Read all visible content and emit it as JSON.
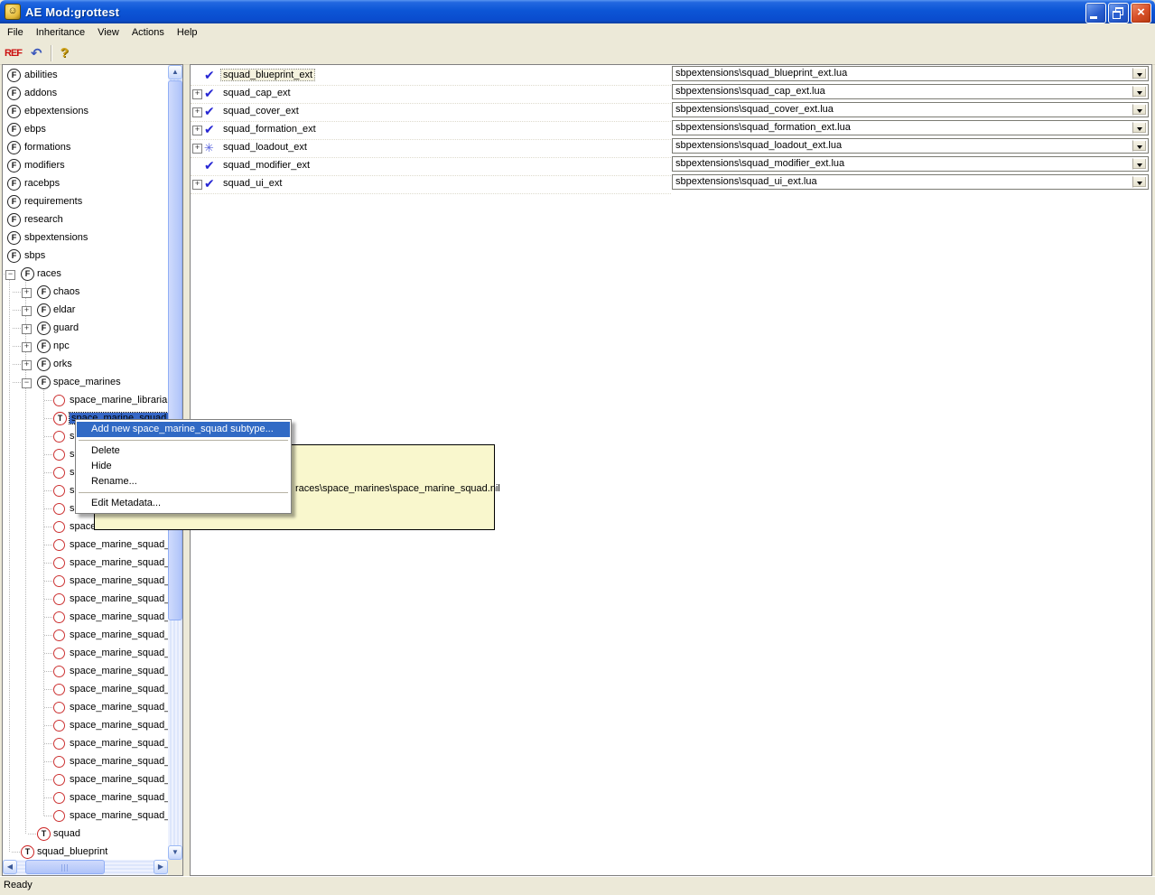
{
  "window": {
    "title": "AE Mod:grottest",
    "buttons": {
      "minimize": "minimize",
      "restore": "restore",
      "close": "close"
    }
  },
  "menu_bar": {
    "items": [
      "File",
      "Inheritance",
      "View",
      "Actions",
      "Help"
    ]
  },
  "toolbar": {
    "ref_label": "REF",
    "undo_glyph": "↶",
    "help_glyph": "?"
  },
  "tree": {
    "items": [
      {
        "label": "abilities",
        "icon": "folder-f",
        "level": 0
      },
      {
        "label": "addons",
        "icon": "folder-f",
        "level": 0
      },
      {
        "label": "ebpextensions",
        "icon": "folder-f",
        "level": 0
      },
      {
        "label": "ebps",
        "icon": "folder-f",
        "level": 0
      },
      {
        "label": "formations",
        "icon": "folder-f",
        "level": 0
      },
      {
        "label": "modifiers",
        "icon": "folder-f",
        "level": 0
      },
      {
        "label": "racebps",
        "icon": "folder-f",
        "level": 0
      },
      {
        "label": "requirements",
        "icon": "folder-f",
        "level": 0
      },
      {
        "label": "research",
        "icon": "folder-f",
        "level": 0
      },
      {
        "label": "sbpextensions",
        "icon": "folder-f",
        "level": 0
      },
      {
        "label": "sbps",
        "icon": "folder-f",
        "level": 0
      },
      {
        "label": "races",
        "icon": "folder-f",
        "level": 1,
        "box": "minus"
      },
      {
        "label": "chaos",
        "icon": "folder-f",
        "level": 2,
        "box": "plus"
      },
      {
        "label": "eldar",
        "icon": "folder-f",
        "level": 2,
        "box": "plus"
      },
      {
        "label": "guard",
        "icon": "folder-f",
        "level": 2,
        "box": "plus"
      },
      {
        "label": "npc",
        "icon": "folder-f",
        "level": 2,
        "box": "plus"
      },
      {
        "label": "orks",
        "icon": "folder-f",
        "level": 2,
        "box": "plus"
      },
      {
        "label": "space_marines",
        "icon": "folder-f",
        "level": 2,
        "box": "minus"
      },
      {
        "label": "space_marine_librarian",
        "icon": "instance",
        "level": 3
      },
      {
        "label": "space_marine_squad",
        "icon": "type-t",
        "level": 3,
        "selected": true
      },
      {
        "label": "s",
        "icon": "instance",
        "level": 3
      },
      {
        "label": "s",
        "icon": "instance",
        "level": 3
      },
      {
        "label": "s",
        "icon": "instance",
        "level": 3
      },
      {
        "label": "s",
        "icon": "instance",
        "level": 3
      },
      {
        "label": "s",
        "icon": "instance",
        "level": 3
      },
      {
        "label": "space",
        "icon": "instance",
        "level": 3
      },
      {
        "label": "space_marine_squad_",
        "icon": "instance",
        "level": 3
      },
      {
        "label": "space_marine_squad_",
        "icon": "instance",
        "level": 3
      },
      {
        "label": "space_marine_squad_",
        "icon": "instance",
        "level": 3
      },
      {
        "label": "space_marine_squad_",
        "icon": "instance",
        "level": 3
      },
      {
        "label": "space_marine_squad_",
        "icon": "instance",
        "level": 3
      },
      {
        "label": "space_marine_squad_",
        "icon": "instance",
        "level": 3
      },
      {
        "label": "space_marine_squad_",
        "icon": "instance",
        "level": 3
      },
      {
        "label": "space_marine_squad_",
        "icon": "instance",
        "level": 3
      },
      {
        "label": "space_marine_squad_",
        "icon": "instance",
        "level": 3
      },
      {
        "label": "space_marine_squad_",
        "icon": "instance",
        "level": 3
      },
      {
        "label": "space_marine_squad_",
        "icon": "instance",
        "level": 3
      },
      {
        "label": "space_marine_squad_",
        "icon": "instance",
        "level": 3
      },
      {
        "label": "space_marine_squad_",
        "icon": "instance",
        "level": 3
      },
      {
        "label": "space_marine_squad_",
        "icon": "instance",
        "level": 3
      },
      {
        "label": "space_marine_squad_",
        "icon": "instance",
        "level": 3
      },
      {
        "label": "space_marine_squad_",
        "icon": "instance",
        "level": 3
      },
      {
        "label": "squad",
        "icon": "type-t",
        "level": 2
      },
      {
        "label": "squad_blueprint",
        "icon": "type-t",
        "level": 1
      }
    ]
  },
  "right_panel": {
    "rows": [
      {
        "label": "squad_blueprint_ext",
        "icon": "check",
        "expand": false,
        "selected": true,
        "value": "sbpextensions\\squad_blueprint_ext.lua"
      },
      {
        "label": "squad_cap_ext",
        "icon": "check",
        "expand": true,
        "value": "sbpextensions\\squad_cap_ext.lua"
      },
      {
        "label": "squad_cover_ext",
        "icon": "check",
        "expand": true,
        "value": "sbpextensions\\squad_cover_ext.lua"
      },
      {
        "label": "squad_formation_ext",
        "icon": "check",
        "expand": true,
        "value": "sbpextensions\\squad_formation_ext.lua"
      },
      {
        "label": "squad_loadout_ext",
        "icon": "asterisk",
        "expand": true,
        "value": "sbpextensions\\squad_loadout_ext.lua"
      },
      {
        "label": "squad_modifier_ext",
        "icon": "check",
        "expand": false,
        "value": "sbpextensions\\squad_modifier_ext.lua"
      },
      {
        "label": "squad_ui_ext",
        "icon": "check",
        "expand": true,
        "value": "sbpextensions\\squad_ui_ext.lua"
      }
    ]
  },
  "context_menu": {
    "items": [
      {
        "label": "Add new space_marine_squad subtype...",
        "highlighted": true
      },
      {
        "separator": true
      },
      {
        "label": "Delete"
      },
      {
        "label": "Hide"
      },
      {
        "label": "Rename..."
      },
      {
        "separator": true
      },
      {
        "label": "Edit Metadata..."
      }
    ]
  },
  "tooltip": {
    "text": "races\\space_marines\\space_marine_squad.nil"
  },
  "status_bar": {
    "text": "Ready"
  },
  "colors": {
    "titlebar_blue": "#0c55d6",
    "selection_blue": "#3667c6",
    "menu_highlight": "#316ac5",
    "tooltip_yellow": "#f9f7cd",
    "check_blue": "#2727d4",
    "instance_red": "#cc3333"
  }
}
